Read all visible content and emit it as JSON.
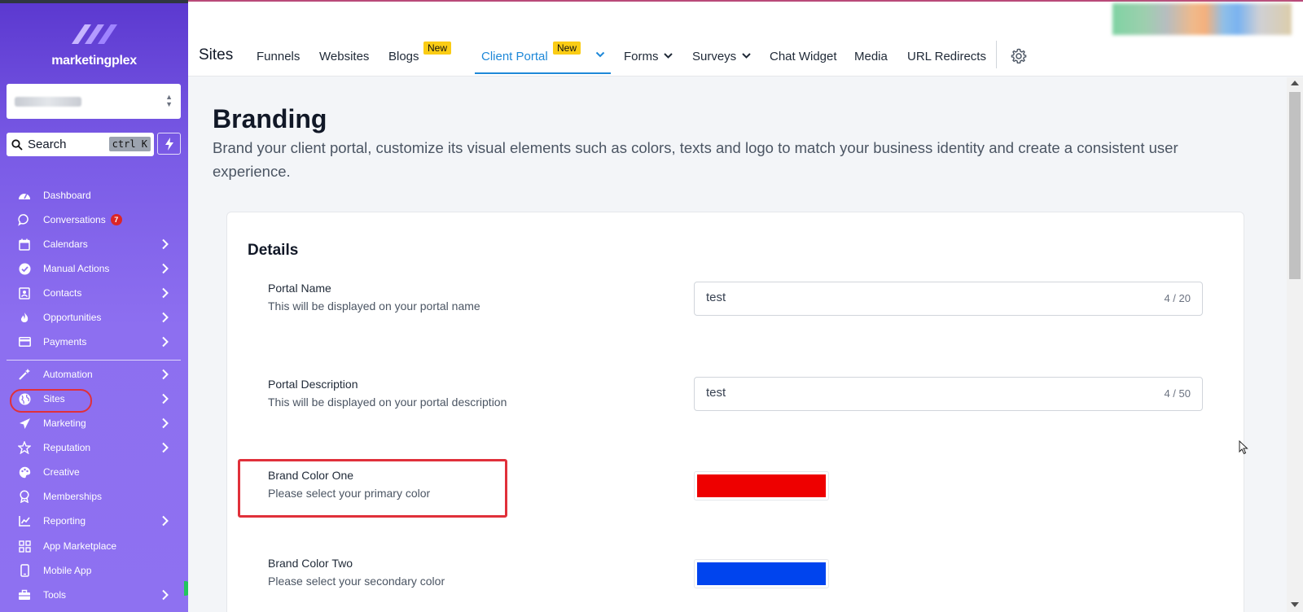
{
  "brand": {
    "name": "marketingplex"
  },
  "sidebar": {
    "search": {
      "placeholder": "Search",
      "shortcut": "ctrl K"
    },
    "items": [
      {
        "label": "Dashboard",
        "icon": "dashboard-icon"
      },
      {
        "label": "Conversations",
        "icon": "chat-icon",
        "badge": "7"
      },
      {
        "label": "Calendars",
        "icon": "calendar-icon"
      },
      {
        "label": "Manual Actions",
        "icon": "check-circle-icon"
      },
      {
        "label": "Contacts",
        "icon": "contact-card-icon"
      },
      {
        "label": "Opportunities",
        "icon": "flame-icon"
      },
      {
        "label": "Payments",
        "icon": "credit-card-icon"
      },
      {
        "label": "Automation",
        "icon": "magic-wand-icon"
      },
      {
        "label": "Sites",
        "icon": "globe-icon"
      },
      {
        "label": "Marketing",
        "icon": "paper-plane-icon"
      },
      {
        "label": "Reputation",
        "icon": "star-icon"
      },
      {
        "label": "Creative",
        "icon": "palette-icon"
      },
      {
        "label": "Memberships",
        "icon": "award-icon"
      },
      {
        "label": "Reporting",
        "icon": "chart-line-icon"
      },
      {
        "label": "App Marketplace",
        "icon": "grid-icon"
      },
      {
        "label": "Mobile App",
        "icon": "mobile-icon"
      },
      {
        "label": "Tools",
        "icon": "toolbox-icon"
      }
    ]
  },
  "topbar": {
    "title": "Sites",
    "tabs": [
      {
        "label": "Funnels"
      },
      {
        "label": "Websites"
      },
      {
        "label": "Blogs",
        "badge": "New"
      },
      {
        "label": "Client Portal",
        "badge": "New",
        "active": true
      },
      {
        "label": "Forms"
      },
      {
        "label": "Surveys"
      },
      {
        "label": "Chat Widget"
      },
      {
        "label": "Media"
      },
      {
        "label": "URL Redirects"
      }
    ]
  },
  "page": {
    "title": "Branding",
    "description": "Brand your client portal, customize its visual elements such as colors, texts and logo to match your business identity and create a consistent user experience."
  },
  "details": {
    "title": "Details",
    "portal_name": {
      "label": "Portal Name",
      "help": "This will be displayed on your portal name",
      "value": "test",
      "counter": "4 / 20"
    },
    "portal_description": {
      "label": "Portal Description",
      "help": "This will be displayed on your portal description",
      "value": "test",
      "counter": "4 / 50"
    },
    "brand_color_one": {
      "label": "Brand Color One",
      "help": "Please select your primary color",
      "color": "#ee0000"
    },
    "brand_color_two": {
      "label": "Brand Color Two",
      "help": "Please select your secondary color",
      "color": "#0044ee"
    }
  },
  "colors": {
    "accent": "#1e88d8",
    "sidebar": "#8d6ff0",
    "highlight": "#e0303a",
    "badge_new": "#facc15"
  }
}
